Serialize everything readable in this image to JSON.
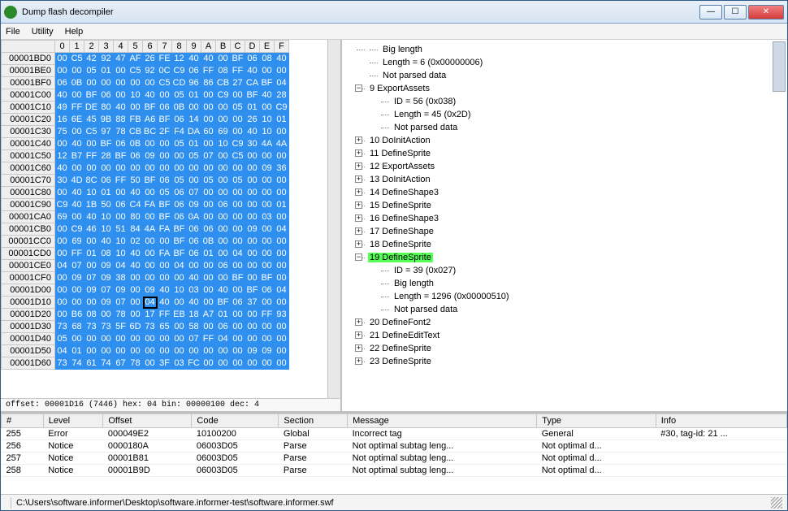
{
  "window": {
    "title": "Dump flash decompiler"
  },
  "menu": {
    "file": "File",
    "utility": "Utility",
    "help": "Help"
  },
  "hex": {
    "columns": [
      "0",
      "1",
      "2",
      "3",
      "4",
      "5",
      "6",
      "7",
      "8",
      "9",
      "A",
      "B",
      "C",
      "D",
      "E",
      "F"
    ],
    "rows": [
      {
        "addr": "00001BD0",
        "b": [
          "00",
          "C5",
          "42",
          "92",
          "47",
          "AF",
          "26",
          "FE",
          "12",
          "40",
          "40",
          "00",
          "BF",
          "06",
          "08",
          "40"
        ]
      },
      {
        "addr": "00001BE0",
        "b": [
          "00",
          "00",
          "05",
          "01",
          "00",
          "C5",
          "92",
          "0C",
          "C9",
          "06",
          "FF",
          "08",
          "FF",
          "40",
          "00",
          "00"
        ]
      },
      {
        "addr": "00001BF0",
        "b": [
          "06",
          "0B",
          "00",
          "00",
          "00",
          "00",
          "00",
          "C5",
          "CD",
          "96",
          "86",
          "CB",
          "27",
          "CA",
          "BF",
          "04"
        ]
      },
      {
        "addr": "00001C00",
        "b": [
          "40",
          "00",
          "BF",
          "06",
          "00",
          "10",
          "40",
          "00",
          "05",
          "01",
          "00",
          "C9",
          "00",
          "BF",
          "40",
          "28"
        ]
      },
      {
        "addr": "00001C10",
        "b": [
          "49",
          "FF",
          "DE",
          "80",
          "40",
          "00",
          "BF",
          "06",
          "0B",
          "00",
          "00",
          "00",
          "05",
          "01",
          "00",
          "C9"
        ]
      },
      {
        "addr": "00001C20",
        "b": [
          "16",
          "6E",
          "45",
          "9B",
          "88",
          "FB",
          "A6",
          "BF",
          "06",
          "14",
          "00",
          "00",
          "00",
          "26",
          "10",
          "01"
        ]
      },
      {
        "addr": "00001C30",
        "b": [
          "75",
          "00",
          "C5",
          "97",
          "78",
          "CB",
          "BC",
          "2F",
          "F4",
          "DA",
          "60",
          "69",
          "00",
          "40",
          "10",
          "00"
        ]
      },
      {
        "addr": "00001C40",
        "b": [
          "00",
          "40",
          "00",
          "BF",
          "06",
          "0B",
          "00",
          "00",
          "05",
          "01",
          "00",
          "10",
          "C9",
          "30",
          "4A",
          "4A"
        ]
      },
      {
        "addr": "00001C50",
        "b": [
          "12",
          "B7",
          "FF",
          "28",
          "BF",
          "06",
          "09",
          "00",
          "00",
          "05",
          "07",
          "00",
          "C5",
          "00",
          "00",
          "00"
        ]
      },
      {
        "addr": "00001C60",
        "b": [
          "40",
          "00",
          "00",
          "00",
          "00",
          "00",
          "00",
          "00",
          "00",
          "00",
          "00",
          "00",
          "00",
          "00",
          "09",
          "36"
        ]
      },
      {
        "addr": "00001C70",
        "b": [
          "30",
          "4D",
          "8C",
          "06",
          "FF",
          "50",
          "BF",
          "06",
          "05",
          "00",
          "05",
          "00",
          "05",
          "00",
          "00",
          "00"
        ]
      },
      {
        "addr": "00001C80",
        "b": [
          "00",
          "40",
          "10",
          "01",
          "00",
          "40",
          "00",
          "05",
          "06",
          "07",
          "00",
          "00",
          "00",
          "00",
          "00",
          "00"
        ]
      },
      {
        "addr": "00001C90",
        "b": [
          "C9",
          "40",
          "1B",
          "50",
          "06",
          "C4",
          "FA",
          "BF",
          "06",
          "09",
          "00",
          "06",
          "00",
          "00",
          "00",
          "01"
        ]
      },
      {
        "addr": "00001CA0",
        "b": [
          "69",
          "00",
          "40",
          "10",
          "00",
          "80",
          "00",
          "BF",
          "06",
          "0A",
          "00",
          "00",
          "00",
          "00",
          "03",
          "00"
        ]
      },
      {
        "addr": "00001CB0",
        "b": [
          "00",
          "C9",
          "46",
          "10",
          "51",
          "84",
          "4A",
          "FA",
          "BF",
          "06",
          "06",
          "00",
          "00",
          "09",
          "00",
          "04"
        ]
      },
      {
        "addr": "00001CC0",
        "b": [
          "00",
          "69",
          "00",
          "40",
          "10",
          "02",
          "00",
          "00",
          "BF",
          "06",
          "0B",
          "00",
          "00",
          "00",
          "00",
          "00"
        ]
      },
      {
        "addr": "00001CD0",
        "b": [
          "00",
          "FF",
          "01",
          "08",
          "10",
          "40",
          "00",
          "FA",
          "BF",
          "06",
          "01",
          "00",
          "04",
          "00",
          "00",
          "00"
        ]
      },
      {
        "addr": "00001CE0",
        "b": [
          "04",
          "07",
          "00",
          "09",
          "04",
          "40",
          "00",
          "00",
          "04",
          "00",
          "00",
          "06",
          "00",
          "00",
          "00",
          "00"
        ]
      },
      {
        "addr": "00001CF0",
        "b": [
          "00",
          "09",
          "07",
          "09",
          "38",
          "00",
          "00",
          "00",
          "00",
          "40",
          "00",
          "00",
          "BF",
          "00",
          "BF",
          "00"
        ]
      },
      {
        "addr": "00001D00",
        "b": [
          "00",
          "00",
          "09",
          "07",
          "09",
          "00",
          "09",
          "40",
          "10",
          "03",
          "00",
          "40",
          "00",
          "BF",
          "06",
          "04"
        ]
      },
      {
        "addr": "00001D10",
        "b": [
          "00",
          "00",
          "00",
          "09",
          "07",
          "00",
          "04",
          "40",
          "00",
          "40",
          "00",
          "BF",
          "06",
          "37",
          "00",
          "00"
        ]
      },
      {
        "addr": "00001D20",
        "b": [
          "00",
          "B6",
          "08",
          "00",
          "78",
          "00",
          "17",
          "FF",
          "EB",
          "18",
          "A7",
          "01",
          "00",
          "00",
          "FF",
          "93"
        ]
      },
      {
        "addr": "00001D30",
        "b": [
          "73",
          "68",
          "73",
          "73",
          "5F",
          "6D",
          "73",
          "65",
          "00",
          "58",
          "00",
          "06",
          "00",
          "00",
          "00",
          "00"
        ]
      },
      {
        "addr": "00001D40",
        "b": [
          "05",
          "00",
          "00",
          "00",
          "00",
          "00",
          "00",
          "00",
          "00",
          "07",
          "FF",
          "04",
          "00",
          "00",
          "00",
          "00"
        ]
      },
      {
        "addr": "00001D50",
        "b": [
          "04",
          "01",
          "00",
          "00",
          "00",
          "00",
          "00",
          "00",
          "00",
          "00",
          "00",
          "00",
          "00",
          "09",
          "09",
          "00"
        ]
      },
      {
        "addr": "00001D60",
        "b": [
          "73",
          "74",
          "61",
          "74",
          "67",
          "78",
          "00",
          "3F",
          "03",
          "FC",
          "00",
          "00",
          "00",
          "00",
          "00",
          "00"
        ]
      }
    ],
    "selected": {
      "row": 20,
      "col": 6
    },
    "status": "offset: 00001D16 (7446)    hex: 04    bin: 00000100    dec: 4"
  },
  "tree": {
    "top_leaves": [
      "Big length",
      "Length = 6 (0x00000006)",
      "Not parsed data"
    ],
    "node9": {
      "label": "9 ExportAssets",
      "children": [
        "ID = 56 (0x038)",
        "Length = 45 (0x2D)",
        "Not parsed data"
      ]
    },
    "mid_nodes": [
      "10 DoInitAction",
      "11 DefineSprite",
      "12 ExportAssets",
      "13 DoInitAction",
      "14 DefineShape3",
      "15 DefineSprite",
      "16 DefineShape3",
      "17 DefineShape",
      "18 DefineSprite"
    ],
    "node19": {
      "label": "19 DefineSprite",
      "children": [
        "ID = 39 (0x027)",
        "Big length",
        "Length = 1296 (0x00000510)",
        "Not parsed data"
      ]
    },
    "tail_nodes": [
      "20 DefineFont2",
      "21 DefineEditText",
      "22 DefineSprite",
      "23 DefineSprite"
    ]
  },
  "log": {
    "headers": {
      "num": "#",
      "level": "Level",
      "offset": "Offset",
      "code": "Code",
      "section": "Section",
      "message": "Message",
      "type": "Type",
      "info": "Info"
    },
    "rows": [
      {
        "num": "255",
        "level": "Error",
        "offset": "000049E2",
        "code": "10100200",
        "section": "Global",
        "message": "Incorrect tag",
        "type": "General",
        "info": "#30, tag-id: 21 ..."
      },
      {
        "num": "256",
        "level": "Notice",
        "offset": "0000180A",
        "code": "06003D05",
        "section": "Parse",
        "message": "Not optimal subtag leng...",
        "type": "Not optimal d...",
        "info": ""
      },
      {
        "num": "257",
        "level": "Notice",
        "offset": "00001B81",
        "code": "06003D05",
        "section": "Parse",
        "message": "Not optimal subtag leng...",
        "type": "Not optimal d...",
        "info": ""
      },
      {
        "num": "258",
        "level": "Notice",
        "offset": "00001B9D",
        "code": "06003D05",
        "section": "Parse",
        "message": "Not optimal subtag leng...",
        "type": "Not optimal d...",
        "info": ""
      }
    ]
  },
  "statusbar": {
    "path": "C:\\Users\\software.informer\\Desktop\\software.informer-test\\software.informer.swf"
  }
}
